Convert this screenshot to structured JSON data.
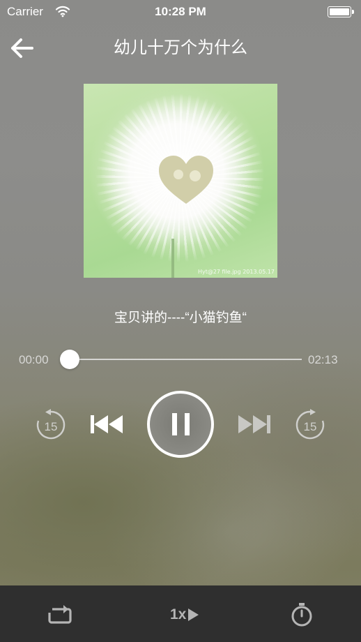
{
  "status_bar": {
    "carrier": "Carrier",
    "time": "10:28 PM",
    "wifi_icon": "wifi-icon",
    "battery_icon": "battery-icon"
  },
  "header": {
    "back_icon": "arrow-left-icon",
    "title": "幼儿十万个为什么"
  },
  "cover": {
    "description_icon": "dandelion-cover-image",
    "watermark": "Hyt@27 file.jpg 2013.05.17"
  },
  "track": {
    "title": "宝贝讲的----“小猫钓鱼“"
  },
  "progress": {
    "current": "00:00",
    "total": "02:13",
    "fraction": 0
  },
  "controls": {
    "skip_back_seconds": "15",
    "skip_forward_seconds": "15",
    "state": "playing",
    "icons": [
      "rewind-15-icon",
      "previous-track-icon",
      "pause-icon",
      "next-track-icon",
      "forward-15-icon"
    ]
  },
  "bottom_bar": {
    "repeat_icon": "repeat-icon",
    "speed_label": "1x",
    "timer_icon": "stopwatch-icon"
  },
  "colors": {
    "text": "#ffffff",
    "secondary_text": "#d8d8d6",
    "bottom_bar": "#2f2f2f",
    "bottom_icons": "#b5b5b5"
  }
}
